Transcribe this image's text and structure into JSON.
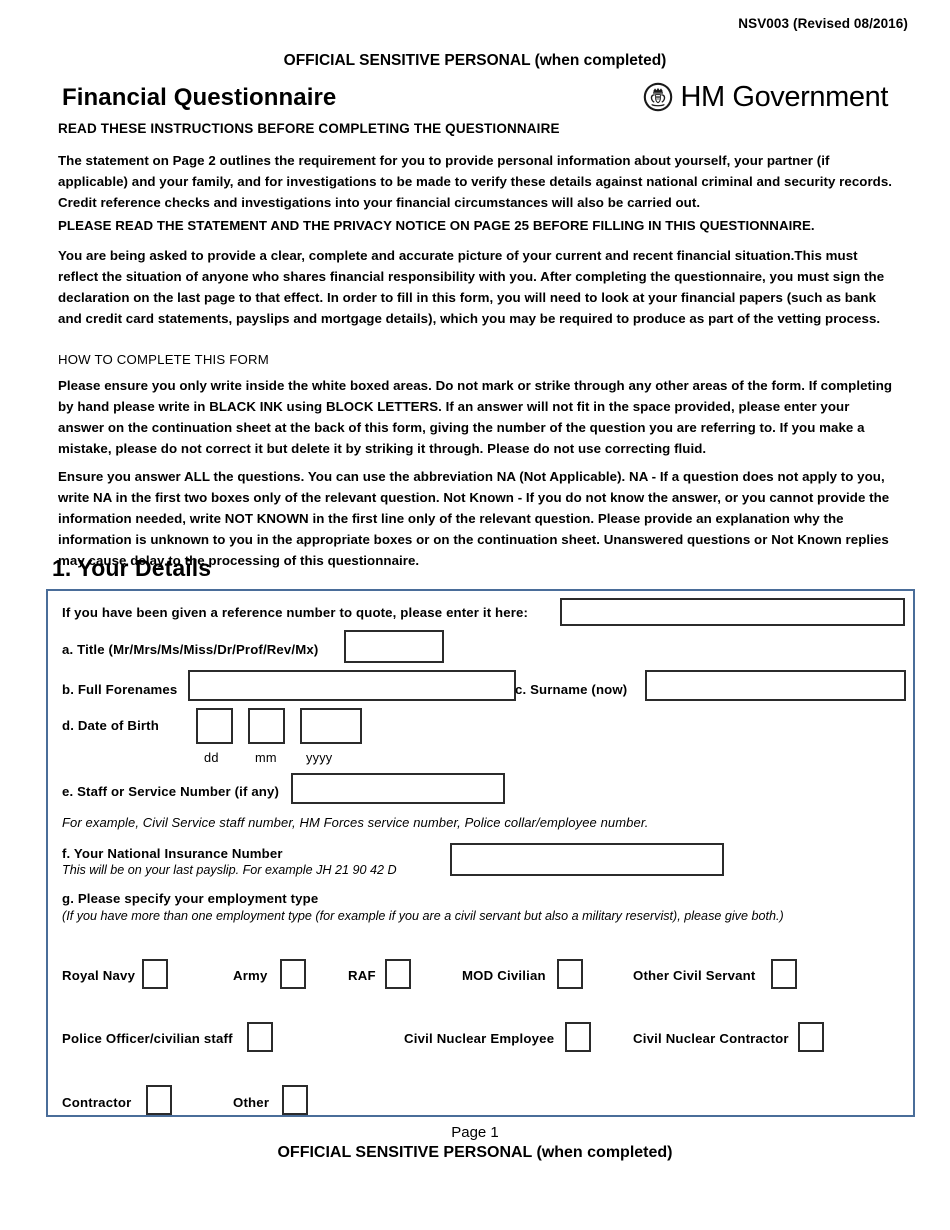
{
  "header": {
    "doc_code": "NSV003 (Revised 08/2016)",
    "classification": "OFFICIAL SENSITIVE PERSONAL (when completed)",
    "form_title": "Financial Questionnaire",
    "logo_text": "HM Government",
    "logo_icon": "royal-crest-icon",
    "read_instructions": "READ THESE INSTRUCTIONS BEFORE COMPLETING THE QUESTIONNAIRE"
  },
  "instructions": {
    "paragraph_1": "The statement on Page 2 outlines the requirement for you to provide personal information about yourself, your partner (if applicable) and your family, and for investigations to be made to verify these details against national criminal and security records. Credit reference checks and investigations into your financial circumstances will also be carried out.",
    "paragraph_2": "PLEASE READ THE STATEMENT AND THE PRIVACY NOTICE ON PAGE 25 BEFORE FILLING IN THIS QUESTIONNAIRE.",
    "paragraph_3": "You are being asked to provide a clear, complete and accurate picture of your current and recent financial situation.This must reflect the situation of anyone who shares financial responsibility with you. After completing the questionnaire, you must sign the declaration on the last page to that effect. In order to fill in this form, you will need to look at your financial papers (such as bank and credit card statements, payslips and mortgage details), which you may be required to produce as part of the vetting process.",
    "how_to_heading": "HOW TO COMPLETE THIS FORM",
    "paragraph_4": "Please ensure you only write inside the white boxed areas. Do not mark or strike through any other areas of the form. If completing by hand please write in BLACK INK using BLOCK LETTERS. If an answer will not fit in the space provided, please enter your answer on the continuation sheet at the back of this form, giving the number of the question you are referring to. If you make a mistake, please do not correct it but delete it by striking it through. Please do not use correcting fluid.",
    "paragraph_5": "Ensure you answer ALL the questions. You can use the abbreviation NA (Not Applicable). NA - If a question does not apply to you, write NA in the first two boxes only of the relevant question. Not Known - If you do not know the answer, or you cannot provide the information needed, write NOT KNOWN in the first line only of the relevant question. Please provide an explanation why the information is unknown to you in the appropriate boxes or on the continuation sheet. Unanswered questions or Not Known replies may cause delay to the processing of this questionnaire."
  },
  "section1": {
    "heading": "1. Your Details",
    "reference_label": "If you have been given a reference number to quote, please enter it here:",
    "reference_value": "",
    "title_label": "a. Title (Mr/Mrs/Ms/Miss/Dr/Prof/Rev/Mx)",
    "title_value": "",
    "forenames_label": "b. Full Forenames",
    "forenames_value": "",
    "surname_label": "c. Surname (now)",
    "surname_value": "",
    "dob_label": "d. Date of Birth",
    "dob_dd_hint": "dd",
    "dob_mm_hint": "mm",
    "dob_yyyy_hint": "yyyy",
    "dob_dd_value": "",
    "dob_mm_value": "",
    "dob_yyyy_value": "",
    "staff_number_label": "e. Staff or Service Number (if any)",
    "staff_number_value": "",
    "staff_number_hint": "For example, Civil Service staff number, HM Forces service number, Police collar/employee number.",
    "ni_label": "f. Your National Insurance Number",
    "ni_hint": "This will be on your last payslip. For example JH 21 90 42 D",
    "ni_value": "",
    "employment_label": "g. Please specify your employment type",
    "employment_hint": "(If you have more than one employment type (for example if you are a civil servant but also a military reservist), please give both.)",
    "employment_options": [
      {
        "label": "Royal Navy",
        "checked": false
      },
      {
        "label": "Army",
        "checked": false
      },
      {
        "label": "RAF",
        "checked": false
      },
      {
        "label": "MOD Civilian",
        "checked": false
      },
      {
        "label": "Other Civil Servant",
        "checked": false
      },
      {
        "label": "Police Officer/civilian staff",
        "checked": false
      },
      {
        "label": "Civil Nuclear Employee",
        "checked": false
      },
      {
        "label": "Civil Nuclear Contractor",
        "checked": false
      },
      {
        "label": "Contractor",
        "checked": false
      },
      {
        "label": "Other",
        "checked": false
      }
    ]
  },
  "footer": {
    "page_number": "Page 1",
    "classification": "OFFICIAL SENSITIVE PERSONAL (when completed)"
  },
  "colors": {
    "box_border": "#4a6d99",
    "field_border": "#2b2b2b",
    "text": "#000000"
  }
}
